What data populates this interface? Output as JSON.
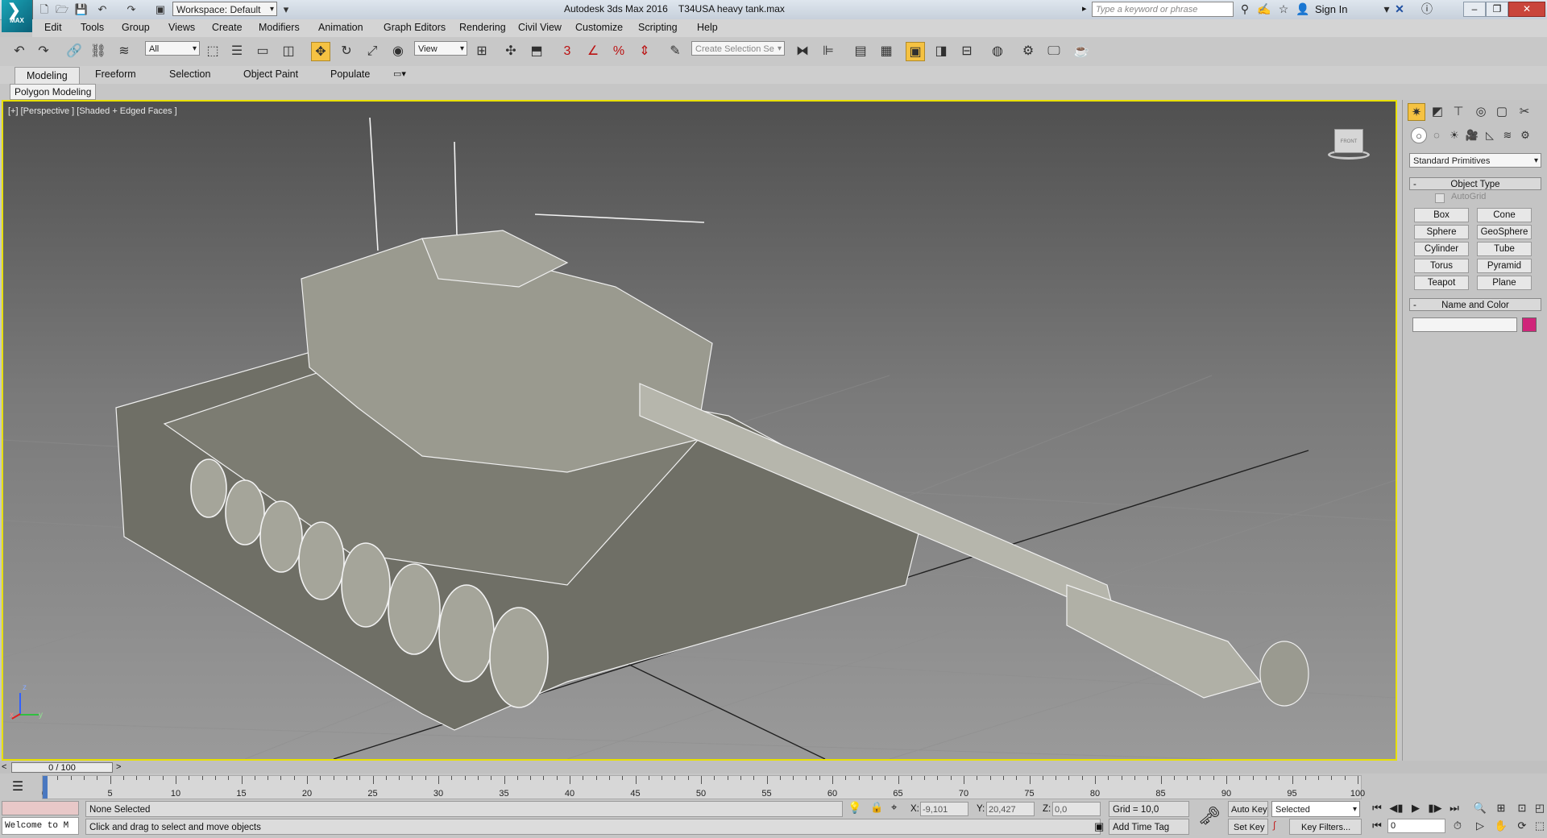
{
  "app": {
    "logo_text": "MAX",
    "title": "Autodesk 3ds Max 2016    T34USA heavy tank.max",
    "workspace": "Workspace: Default",
    "search_placeholder": "Type a keyword or phrase",
    "sign_in": "Sign In"
  },
  "menu": [
    "Edit",
    "Tools",
    "Group",
    "Views",
    "Create",
    "Modifiers",
    "Animation",
    "Graph Editors",
    "Rendering",
    "Civil View",
    "Customize",
    "Scripting",
    "Help"
  ],
  "toolbar": {
    "selection_filter": "All",
    "ref_coord": "View",
    "named_selection": "Create Selection Se",
    "snaps": [
      "3",
      "",
      "%",
      ""
    ]
  },
  "ribbon": {
    "tabs": [
      "Modeling",
      "Freeform",
      "Selection",
      "Object Paint",
      "Populate"
    ],
    "active_tab": "Modeling",
    "panel": "Polygon Modeling"
  },
  "viewport": {
    "label": "[+] [Perspective ] [Shaded + Edged Faces ]",
    "axes": {
      "z": "z",
      "x": "x",
      "y": "y"
    },
    "viewcube_text": "FRONT"
  },
  "command_panel": {
    "category": "Standard Primitives",
    "object_type": {
      "header": "Object Type",
      "autogrid": "AutoGrid",
      "buttons": [
        "Box",
        "Cone",
        "Sphere",
        "GeoSphere",
        "Cylinder",
        "Tube",
        "Torus",
        "Pyramid",
        "Teapot",
        "Plane"
      ]
    },
    "name_color": {
      "header": "Name and Color",
      "name_value": "",
      "color": "#d0257a"
    }
  },
  "timeline": {
    "frame_display": "0 / 100",
    "ticks": [
      "0",
      "5",
      "10",
      "15",
      "20",
      "25",
      "30",
      "35",
      "40",
      "45",
      "50",
      "55",
      "60",
      "65",
      "70",
      "75",
      "80",
      "85",
      "90",
      "95",
      "100"
    ]
  },
  "status": {
    "maxscript": "Welcome to M",
    "selection": "None Selected",
    "prompt": "Click and drag to select and move objects",
    "x_label": "X:",
    "x_value": "-9,101",
    "y_label": "Y:",
    "y_value": "20,427",
    "z_label": "Z:",
    "z_value": "0,0",
    "grid": "Grid = 10,0",
    "add_time_tag": "Add Time Tag",
    "auto_key": "Auto Key",
    "set_key": "Set Key",
    "key_mode": "Selected",
    "key_filters": "Key Filters...",
    "current_frame": "0"
  },
  "colors": {
    "viewport_border": "#e8e000",
    "active_tool": "#f5c242"
  }
}
